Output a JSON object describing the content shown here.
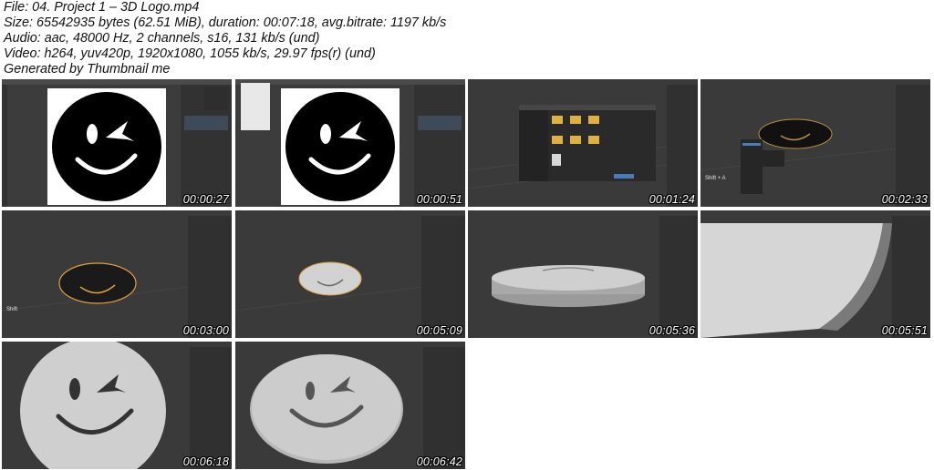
{
  "header": {
    "file": "File: 04. Project 1 – 3D Logo.mp4",
    "size": "Size: 65542935 bytes (62.51 MiB), duration: 00:07:18, avg.bitrate: 1197 kb/s",
    "audio": "Audio: aac, 48000 Hz, 2 channels, s16, 131 kb/s (und)",
    "video": "Video: h264, yuv420p, 1920x1080, 1055 kb/s, 29.97 fps(r) (und)",
    "generator": "Generated by Thumbnail me"
  },
  "thumbnails": [
    {
      "timestamp": "00:00:27",
      "scene": "photoshop-logo"
    },
    {
      "timestamp": "00:00:51",
      "scene": "photoshop-logo-menu"
    },
    {
      "timestamp": "00:01:24",
      "scene": "blender-file-browser"
    },
    {
      "timestamp": "00:02:33",
      "scene": "blender-add-menu",
      "hint": "Shift + A"
    },
    {
      "timestamp": "00:03:00",
      "scene": "blender-curve-outline",
      "hint": "Shift"
    },
    {
      "timestamp": "00:05:09",
      "scene": "blender-filled-curve"
    },
    {
      "timestamp": "00:05:36",
      "scene": "blender-extruded-disk"
    },
    {
      "timestamp": "00:05:51",
      "scene": "blender-closeup-edge"
    },
    {
      "timestamp": "00:06:18",
      "scene": "blender-logo-front"
    },
    {
      "timestamp": "00:06:42",
      "scene": "blender-logo-angled"
    }
  ],
  "colors": {
    "viewport": "#3a3a3a",
    "panel": "#2b2b2b",
    "logo_black": "#000000",
    "logo_white": "#ffffff",
    "mesh_grey": "#c8c8c8",
    "outline_orange": "#e0a040"
  }
}
